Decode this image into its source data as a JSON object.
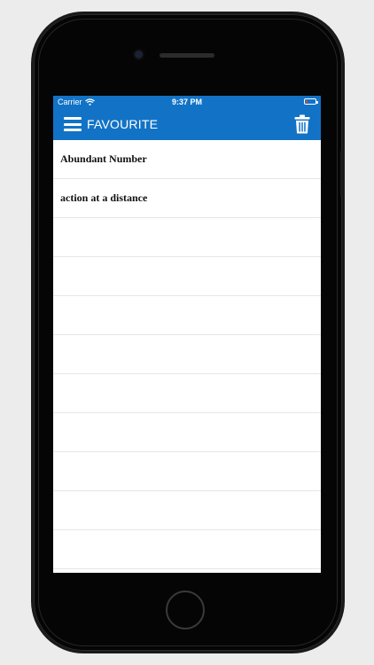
{
  "status_bar": {
    "carrier": "Carrier",
    "time": "9:37 PM",
    "wifi_icon": "wifi-icon",
    "battery_icon": "battery-icon",
    "battery_level": 0.15
  },
  "nav": {
    "title": "FAVOURITE",
    "menu_icon": "hamburger-menu-icon",
    "delete_icon": "trash-icon",
    "bar_color": "#1273c6"
  },
  "favourites": {
    "items": [
      {
        "label": "Abundant Number"
      },
      {
        "label": "action at a distance"
      },
      {
        "label": ""
      },
      {
        "label": ""
      },
      {
        "label": ""
      },
      {
        "label": ""
      },
      {
        "label": ""
      },
      {
        "label": ""
      },
      {
        "label": ""
      },
      {
        "label": ""
      },
      {
        "label": ""
      },
      {
        "label": ""
      }
    ]
  }
}
